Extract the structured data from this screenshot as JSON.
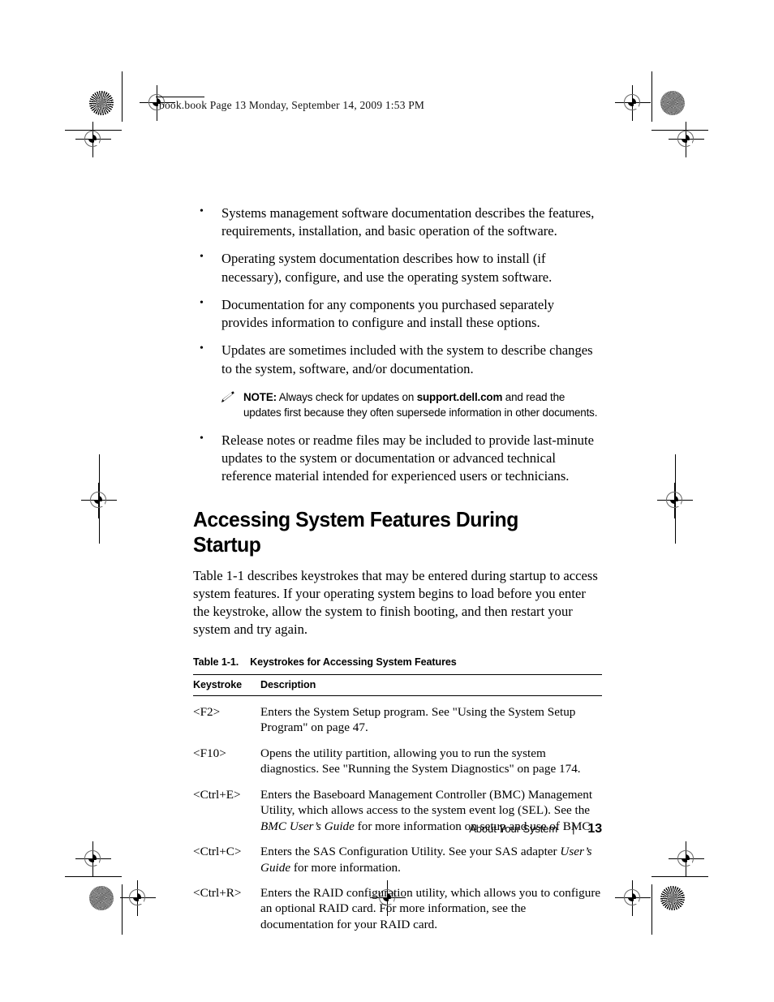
{
  "running_header": "book.book  Page 13  Monday, September 14, 2009  1:53 PM",
  "bullets": [
    "Systems management software documentation describes the features, requirements, installation, and basic operation of the software.",
    "Operating system documentation describes how to install (if necessary), configure, and use the operating system software.",
    "Documentation for any components you purchased separately provides information to configure and install these options.",
    "Updates are sometimes included with the system to describe changes to the system, software, and/or documentation."
  ],
  "note": {
    "icon": "pencil-icon",
    "label": "NOTE:",
    "text_before": " Always check for updates on ",
    "emphasis": "support.dell.com",
    "text_after": " and read the updates first because they often supersede information in other documents."
  },
  "bullet_after_note": "Release notes or readme files may be included to provide last-minute updates to the system or documentation or advanced technical reference material intended for experienced users or technicians.",
  "section": {
    "heading": "Accessing System Features During Startup",
    "intro": "Table 1-1 describes keystrokes that may be entered during startup to access system features. If your operating system begins to load before you enter the keystroke, allow the system to finish booting, and then restart your system and try again."
  },
  "table": {
    "caption_number": "Table 1-1.",
    "caption_title": "Keystrokes for Accessing System Features",
    "headers": [
      "Keystroke",
      "Description"
    ],
    "rows": [
      {
        "keystroke": "<F2>",
        "description_parts": [
          {
            "text": "Enters the System Setup program. See \"Using the System Setup Program\" on page 47.",
            "style": "normal"
          }
        ]
      },
      {
        "keystroke": "<F10>",
        "description_parts": [
          {
            "text": "Opens the utility partition, allowing you to run the system diagnostics. See \"Running the System Diagnostics\" on page 174.",
            "style": "normal"
          }
        ]
      },
      {
        "keystroke": "<Ctrl+E>",
        "description_parts": [
          {
            "text": "Enters the Baseboard Management Controller (BMC) Management Utility, which allows access to the system event log (SEL). See the ",
            "style": "normal"
          },
          {
            "text": "BMC User’s Guide",
            "style": "italic"
          },
          {
            "text": " for more information on setup and use of BMC.",
            "style": "normal"
          }
        ]
      },
      {
        "keystroke": "<Ctrl+C>",
        "description_parts": [
          {
            "text": "Enters the SAS Configuration Utility. See your SAS adapter ",
            "style": "normal"
          },
          {
            "text": "User’s Guide",
            "style": "italic"
          },
          {
            "text": " for more information.",
            "style": "normal"
          }
        ]
      },
      {
        "keystroke": "<Ctrl+R>",
        "description_parts": [
          {
            "text": "Enters the RAID configuration utility, which allows you to configure an optional RAID card. For more information, see the documentation for your RAID card.",
            "style": "normal"
          }
        ]
      }
    ]
  },
  "footer": {
    "section_name": "About Your System",
    "separator": "|",
    "page_number": "13"
  }
}
